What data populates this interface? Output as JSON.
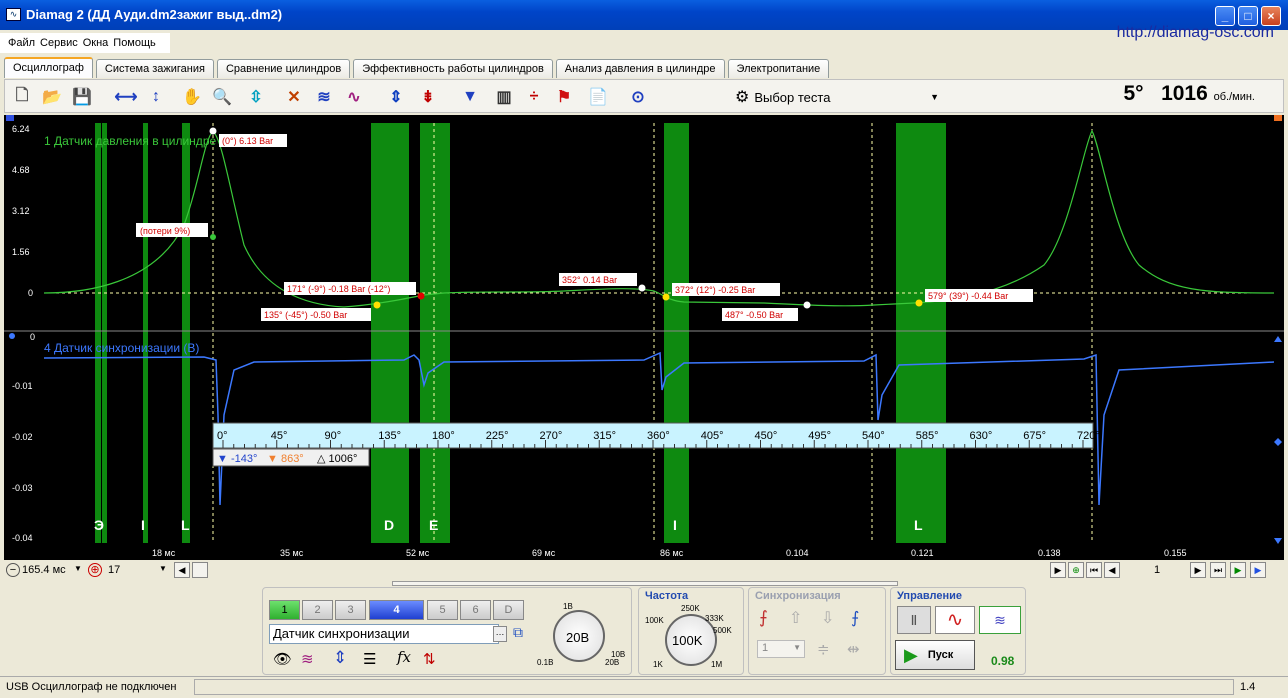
{
  "window": {
    "title": "Diamag 2 (ДД Ауди.dm2зажиг выд..dm2)",
    "site_url": "http://diamag-osc.com"
  },
  "menu": [
    "Файл",
    "Сервис",
    "Окна",
    "Помощь"
  ],
  "tabs": [
    "Осциллограф",
    "Система зажигания",
    "Сравнение цилиндров",
    "Эффективность работы цилиндров",
    "Анализ давления в цилиндре",
    "Электропитание"
  ],
  "toolbar": {
    "test_select_label": "Выбор теста",
    "rpm_angle": "5°",
    "rpm_value": "1016",
    "rpm_unit": "об./мин."
  },
  "channel1": {
    "label": "1 Датчик давления в цилиндре",
    "y_ticks": [
      "6.24",
      "4.68",
      "3.12",
      "1.56",
      "0"
    ],
    "markers": [
      "(0°) 6.13 Bar",
      "(потери 9%)",
      "171° (-9°) -0.18 Bar (-12°)",
      "135° (-45°) -0.50 Bar",
      "352° 0.14 Bar",
      "372° (12°) -0.25 Bar",
      "487° -0.50 Bar",
      "579° (39°) -0.44 Bar"
    ]
  },
  "channel4": {
    "label": "4 Датчик синхронизации  (В)",
    "y_ticks": [
      "0",
      "-0.01",
      "-0.02",
      "-0.03",
      "-0.04"
    ]
  },
  "angle_ruler": {
    "ticks": [
      "0°",
      "45°",
      "90°",
      "135°",
      "180°",
      "225°",
      "270°",
      "315°",
      "360°",
      "405°",
      "450°",
      "495°",
      "540°",
      "585°",
      "630°",
      "675°",
      "720°"
    ],
    "cursor_left": "-143°",
    "cursor_right": "863°",
    "delta": "1006°"
  },
  "zones": [
    "Э",
    "I",
    "L",
    "D",
    "E",
    "I",
    "L"
  ],
  "x_ticks": [
    "18 мс",
    "35 мс",
    "52 мс",
    "69 мс",
    "86 мс",
    "0.104",
    "0.121",
    "0.138",
    "0.155"
  ],
  "navigation": {
    "timebase": "165.4 мс",
    "frames": "17",
    "page": "1"
  },
  "channels_panel": {
    "buttons": [
      "1",
      "2",
      "3",
      "4",
      "5",
      "6",
      "D"
    ],
    "active": "4",
    "sensor": "Датчик синхронизации",
    "range": "20В",
    "range_labels": [
      "1В",
      "0.1В",
      "10В",
      "20В"
    ]
  },
  "frequency_panel": {
    "title": "Частота",
    "value": "100K",
    "labels": [
      "250K",
      "100K",
      "333K",
      "500K",
      "1K",
      "1M"
    ]
  },
  "sync_panel": {
    "title": "Синхронизация",
    "channel": "1"
  },
  "control_panel": {
    "title": "Управление",
    "start_label": "Пуск",
    "value": "0.98"
  },
  "status": {
    "left": "USB Осциллограф не подключен",
    "right": "1.4"
  },
  "colors": {
    "ch1": "#3ac83a",
    "ch4": "#3c78ff",
    "zone": "#0e8a10",
    "label_bg": "#ffffff",
    "label_text": "#d00000"
  }
}
